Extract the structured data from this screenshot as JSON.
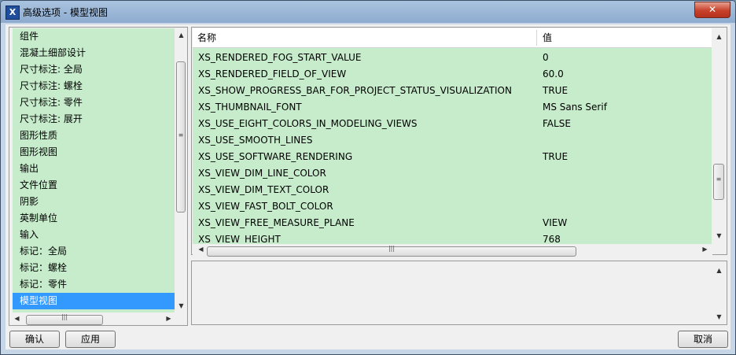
{
  "window": {
    "title": "高级选项 - 模型视图",
    "close_label": "✕",
    "app_icon_glyph": "X"
  },
  "categories": {
    "items": [
      "组件",
      "混凝土细部设计",
      "尺寸标注: 全局",
      "尺寸标注: 螺栓",
      "尺寸标注: 零件",
      "尺寸标注: 展开",
      "图形性质",
      "图形视图",
      "输出",
      "文件位置",
      "阴影",
      "英制单位",
      "输入",
      "标记：全局",
      "标记：螺栓",
      "标记：零件",
      "模型视图"
    ],
    "selected_index": 16,
    "highlight_color": "#3399ff",
    "background_color": "#c6eccb"
  },
  "table": {
    "headers": {
      "name": "名称",
      "value": "值"
    },
    "rows": [
      {
        "name": "XS_RENDERED_FOG_START_VALUE",
        "value": "0"
      },
      {
        "name": "XS_RENDERED_FIELD_OF_VIEW",
        "value": "60.0"
      },
      {
        "name": "XS_SHOW_PROGRESS_BAR_FOR_PROJECT_STATUS_VISUALIZATION",
        "value": "TRUE"
      },
      {
        "name": "XS_THUMBNAIL_FONT",
        "value": "MS Sans Serif"
      },
      {
        "name": "XS_USE_EIGHT_COLORS_IN_MODELING_VIEWS",
        "value": "FALSE"
      },
      {
        "name": "XS_USE_SMOOTH_LINES",
        "value": ""
      },
      {
        "name": "XS_USE_SOFTWARE_RENDERING",
        "value": "TRUE"
      },
      {
        "name": "XS_VIEW_DIM_LINE_COLOR",
        "value": ""
      },
      {
        "name": "XS_VIEW_DIM_TEXT_COLOR",
        "value": ""
      },
      {
        "name": "XS_VIEW_FAST_BOLT_COLOR",
        "value": ""
      },
      {
        "name": "XS_VIEW_FREE_MEASURE_PLANE",
        "value": "VIEW"
      },
      {
        "name": "XS_VIEW_HEIGHT",
        "value": "768"
      }
    ]
  },
  "buttons": {
    "ok": "确认",
    "apply": "应用",
    "cancel": "取消"
  }
}
